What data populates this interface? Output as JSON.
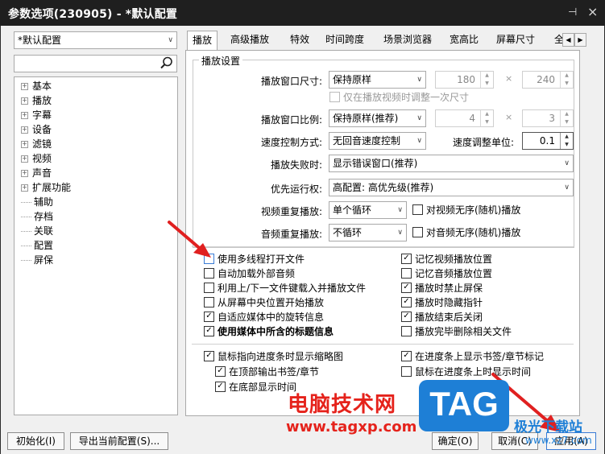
{
  "window": {
    "title": "参数选项(230905) - *默认配置",
    "pin": "⊣",
    "close": "×"
  },
  "profile_select": {
    "value": "*默认配置"
  },
  "search": {
    "placeholder": ""
  },
  "tree": {
    "groups": [
      "基本",
      "播放",
      "字幕",
      "设备",
      "滤镜",
      "视频",
      "声音",
      "扩展功能"
    ],
    "leaves": [
      "辅助",
      "存档",
      "关联",
      "配置",
      "屏保"
    ]
  },
  "tabs": [
    "播放",
    "高级播放",
    "特效",
    "时间跨度",
    "场景浏览器",
    "宽高比",
    "屏幕尺寸",
    "全"
  ],
  "playback": {
    "group_title": "播放设置",
    "window_size": {
      "label": "播放窗口尺寸:",
      "value": "保持原样",
      "w": "180",
      "h": "240",
      "times": "×"
    },
    "adjust_once": {
      "label": "仅在播放视频时调整一次尺寸",
      "checked": false
    },
    "window_ratio": {
      "label": "播放窗口比例:",
      "value": "保持原样(推荐)",
      "w": "4",
      "h": "3",
      "times": "×"
    },
    "speed_mode": {
      "label": "速度控制方式:",
      "value": "无回音速度控制"
    },
    "speed_unit": {
      "label": "速度调整单位:",
      "value": "0.1"
    },
    "on_fail": {
      "label": "播放失败时:",
      "value": "显示错误窗口(推荐)"
    },
    "priority": {
      "label": "优先运行权:",
      "value": "高配置: 高优先级(推荐)"
    },
    "video_repeat": {
      "label": "视频重复播放:",
      "value": "单个循环",
      "check": "对视频无序(随机)播放"
    },
    "audio_repeat": {
      "label": "音频重复播放:",
      "value": "不循环",
      "check": "对音频无序(随机)播放"
    }
  },
  "options_left": [
    {
      "label": "使用多线程打开文件",
      "checked": false
    },
    {
      "label": "自动加载外部音频",
      "checked": false
    },
    {
      "label": "利用上/下一文件键载入并播放文件",
      "checked": false
    },
    {
      "label": "从屏幕中央位置开始播放",
      "checked": false
    },
    {
      "label": "自适应媒体中的旋转信息",
      "checked": true
    },
    {
      "label": "使用媒体中所含的标题信息",
      "checked": true
    }
  ],
  "options_right": [
    {
      "label": "记忆视频播放位置",
      "checked": true
    },
    {
      "label": "记忆音频播放位置",
      "checked": false
    },
    {
      "label": "播放时禁止屏保",
      "checked": true
    },
    {
      "label": "播放时隐藏指针",
      "checked": true
    },
    {
      "label": "播放结束后关闭",
      "checked": true
    },
    {
      "label": "播放完毕删除相关文件",
      "checked": false
    }
  ],
  "seek_options": {
    "thumb": {
      "label": "鼠标指向进度条时显示缩略图",
      "checked": true
    },
    "top_bookmark": {
      "label": "在顶部输出书签/章节",
      "checked": true
    },
    "bottom_time": {
      "label": "在底部显示时间",
      "checked": true
    },
    "show_bookmark": {
      "label": "在进度条上显示书签/章节标记",
      "checked": true
    },
    "show_time": {
      "label": "鼠标在进度条上时显示时间",
      "checked": false
    }
  },
  "buttons": {
    "init": "初始化(I)",
    "export": "导出当前配置(S)...",
    "ok": "确定(O)",
    "cancel": "取消(C)",
    "apply": "应用(A)"
  },
  "watermark": {
    "site_name": "电脑技术网",
    "url": "www.tagxp.com",
    "logo": "TAG",
    "right_text": "极光下载站",
    "right_url": "www.xz7.com"
  },
  "colors": {
    "arrow": "#e02020",
    "logo_bg": "#1e7fd6",
    "watermark_red": "#e5221b"
  }
}
